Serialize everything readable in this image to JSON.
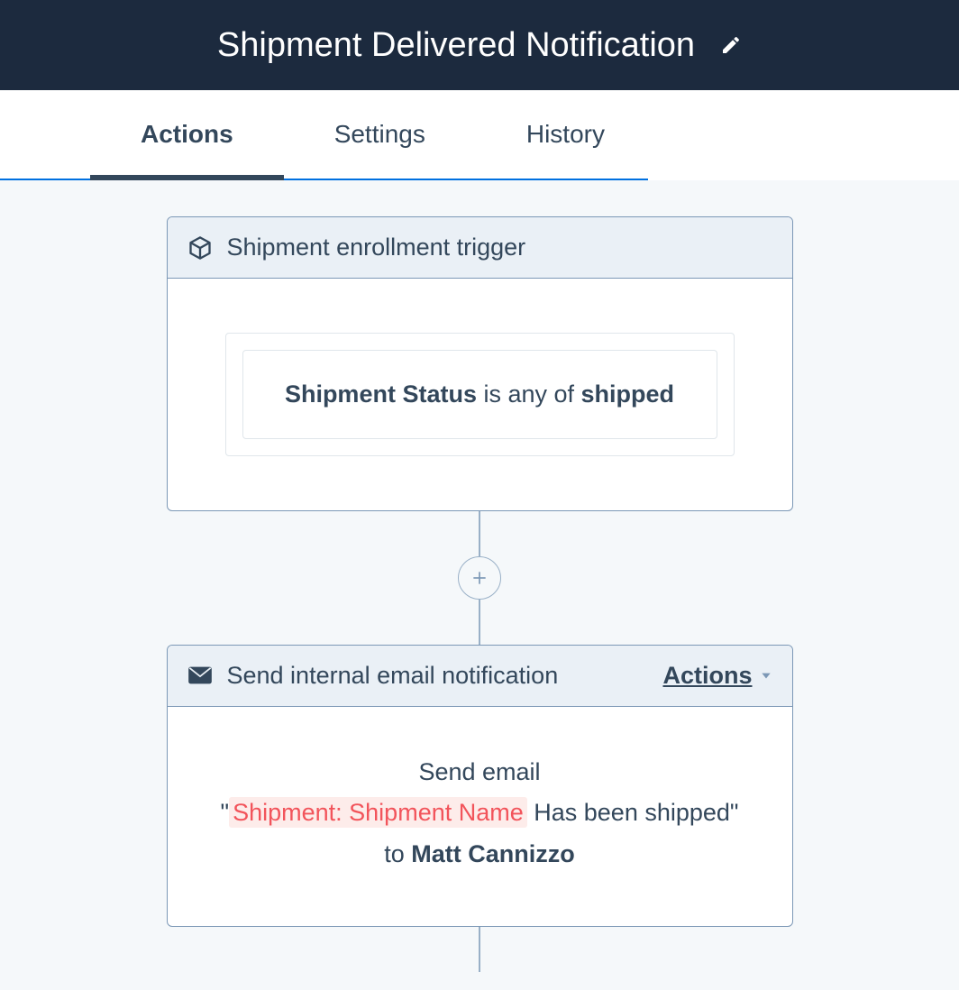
{
  "header": {
    "title": "Shipment Delivered Notification"
  },
  "tabs": [
    {
      "label": "Actions",
      "active": true
    },
    {
      "label": "Settings",
      "active": false
    },
    {
      "label": "History",
      "active": false
    }
  ],
  "trigger": {
    "title": "Shipment enrollment trigger",
    "condition": {
      "field": "Shipment Status",
      "operator": " is any of ",
      "value": "shipped"
    }
  },
  "add_button": "+",
  "email_action": {
    "title": "Send internal email notification",
    "actions_label": "Actions",
    "body": {
      "line1": "Send email",
      "quote_open": "\"",
      "token": "Shipment: Shipment Name",
      "after_token": " Has been shipped\"",
      "to_prefix": "to ",
      "recipient": "Matt Cannizzo"
    }
  }
}
